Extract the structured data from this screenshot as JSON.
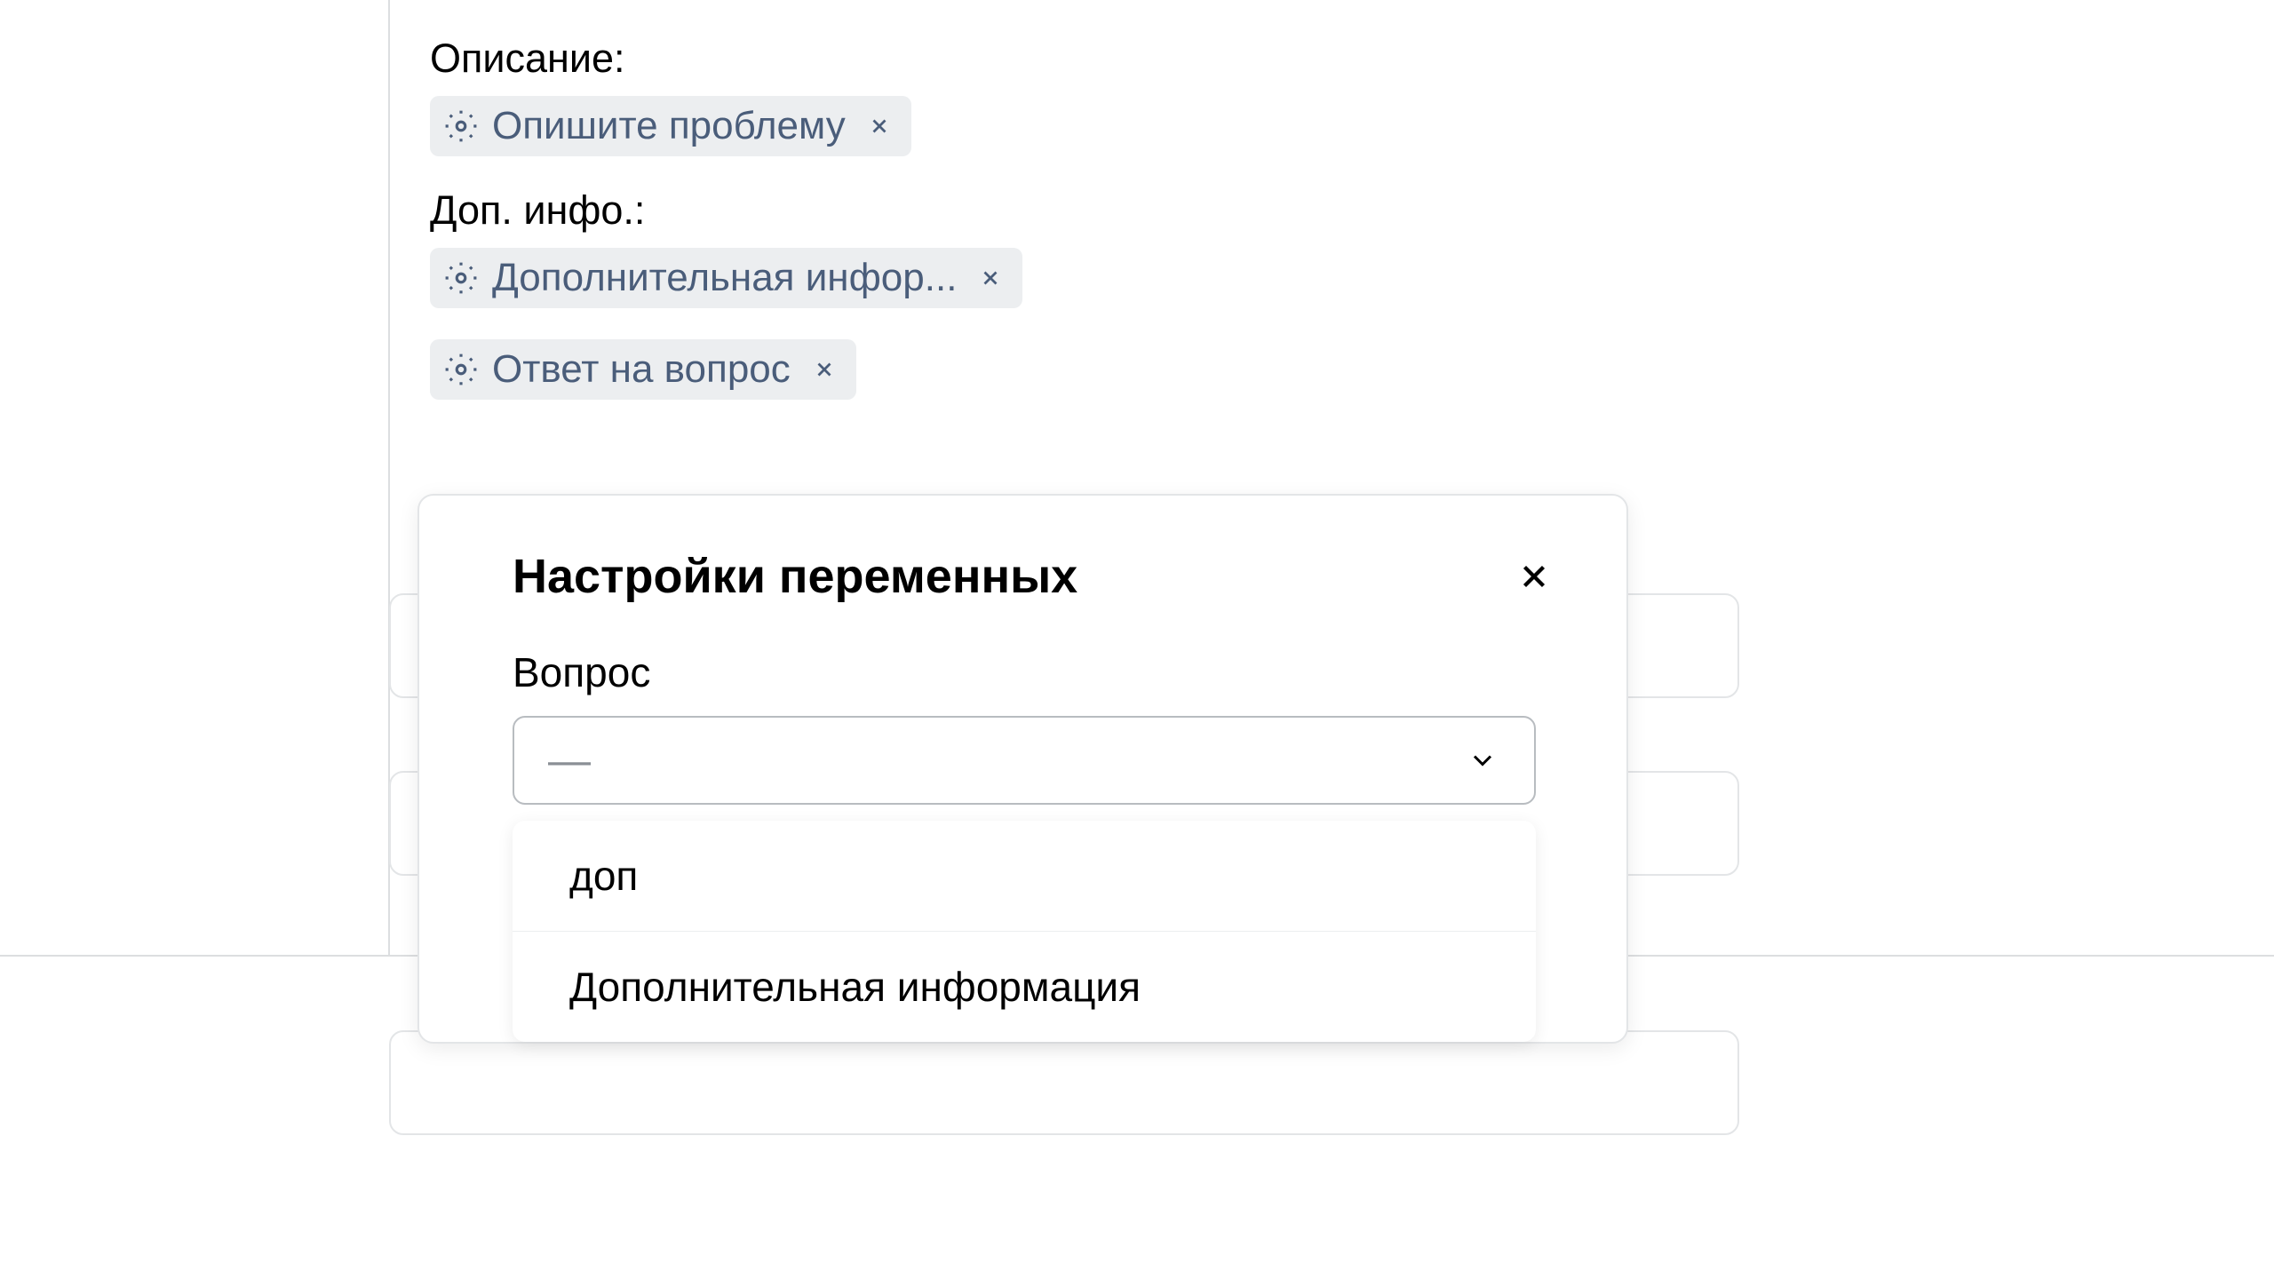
{
  "fields": {
    "description": {
      "label": "Описание:",
      "tags": [
        {
          "text": "Опишите проблему"
        }
      ]
    },
    "additional_info": {
      "label": "Доп. инфо.:",
      "tags": [
        {
          "text": "Дополнительная инфор..."
        },
        {
          "text": "Ответ на вопрос"
        }
      ]
    }
  },
  "modal": {
    "title": "Настройки переменных",
    "field_label": "Вопрос",
    "select_placeholder": "—",
    "options": [
      "доп",
      "Дополнительная информация"
    ]
  }
}
